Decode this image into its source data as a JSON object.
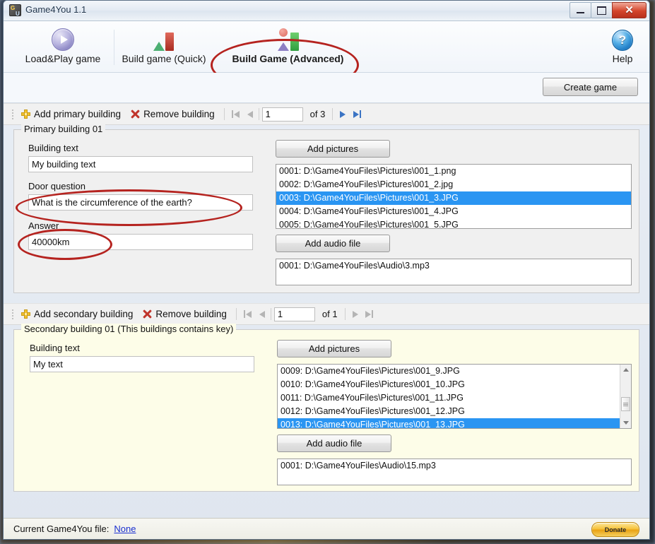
{
  "window": {
    "title": "Game4You 1.1",
    "icon": "app-icon",
    "minimize": "minimize",
    "maximize": "maximize",
    "close": "✕"
  },
  "toolbar": {
    "tabs": [
      {
        "label": "Load&Play game",
        "icon": "play-circle-icon",
        "active": false
      },
      {
        "label": "Build game (Quick)",
        "icon": "quick-build-icon",
        "active": false
      },
      {
        "label": "Build Game (Advanced)",
        "icon": "advanced-build-icon",
        "active": true
      }
    ],
    "help_label": "Help",
    "help_icon": "question-mark-icon",
    "help_glyph": "?"
  },
  "actionbar": {
    "create_game_label": "Create game"
  },
  "annotations": {
    "highlight_color": "#b5231f",
    "circled": [
      "Build Game (Advanced)",
      "Door question field",
      "Answer field"
    ]
  },
  "primary": {
    "nav": {
      "add_label": "Add primary building",
      "remove_label": "Remove building",
      "page_value": "1",
      "of_label": "of 3",
      "first_icon": "first-page-icon",
      "prev_icon": "previous-page-icon",
      "next_icon": "next-page-icon",
      "last_icon": "last-page-icon"
    },
    "legend": "Primary building 01",
    "building_text_label": "Building text",
    "building_text_value": "My building text",
    "door_question_label": "Door question",
    "door_question_value": "What is the circumference of the earth?",
    "answer_label": "Answer",
    "answer_value": "40000km",
    "add_pictures_label": "Add pictures",
    "pictures": [
      {
        "text": "0001:  D:\\Game4YouFiles\\Pictures\\001_1.png",
        "selected": false
      },
      {
        "text": "0002:  D:\\Game4YouFiles\\Pictures\\001_2.jpg",
        "selected": false
      },
      {
        "text": "0003:  D:\\Game4YouFiles\\Pictures\\001_3.JPG",
        "selected": true
      },
      {
        "text": "0004:  D:\\Game4YouFiles\\Pictures\\001_4.JPG",
        "selected": false
      },
      {
        "text": "0005:  D:\\Game4YouFiles\\Pictures\\001_5.JPG",
        "selected": false
      }
    ],
    "add_audio_label": "Add audio file",
    "audio": [
      {
        "text": "0001:  D:\\Game4YouFiles\\Audio\\3.mp3",
        "selected": false
      }
    ]
  },
  "secondary": {
    "nav": {
      "add_label": "Add secondary building",
      "remove_label": "Remove building",
      "page_value": "1",
      "of_label": "of 1",
      "first_icon": "first-page-icon",
      "prev_icon": "previous-page-icon",
      "next_icon": "next-page-icon",
      "last_icon": "last-page-icon"
    },
    "legend": "Secondary building 01 (This buildings contains key)",
    "building_text_label": "Building text",
    "building_text_value": "My text",
    "add_pictures_label": "Add pictures",
    "pictures": [
      {
        "text": "0009:  D:\\Game4YouFiles\\Pictures\\001_9.JPG",
        "selected": false
      },
      {
        "text": "0010:  D:\\Game4YouFiles\\Pictures\\001_10.JPG",
        "selected": false
      },
      {
        "text": "0011:  D:\\Game4YouFiles\\Pictures\\001_11.JPG",
        "selected": false
      },
      {
        "text": "0012:  D:\\Game4YouFiles\\Pictures\\001_12.JPG",
        "selected": false
      },
      {
        "text": "0013:  D:\\Game4YouFiles\\Pictures\\001_13.JPG",
        "selected": true
      }
    ],
    "add_audio_label": "Add audio file",
    "audio": [
      {
        "text": "0001:  D:\\Game4YouFiles\\Audio\\15.mp3",
        "selected": false
      }
    ]
  },
  "statusbar": {
    "label": "Current Game4You file:",
    "file": "None",
    "donate_label": "Donate"
  }
}
